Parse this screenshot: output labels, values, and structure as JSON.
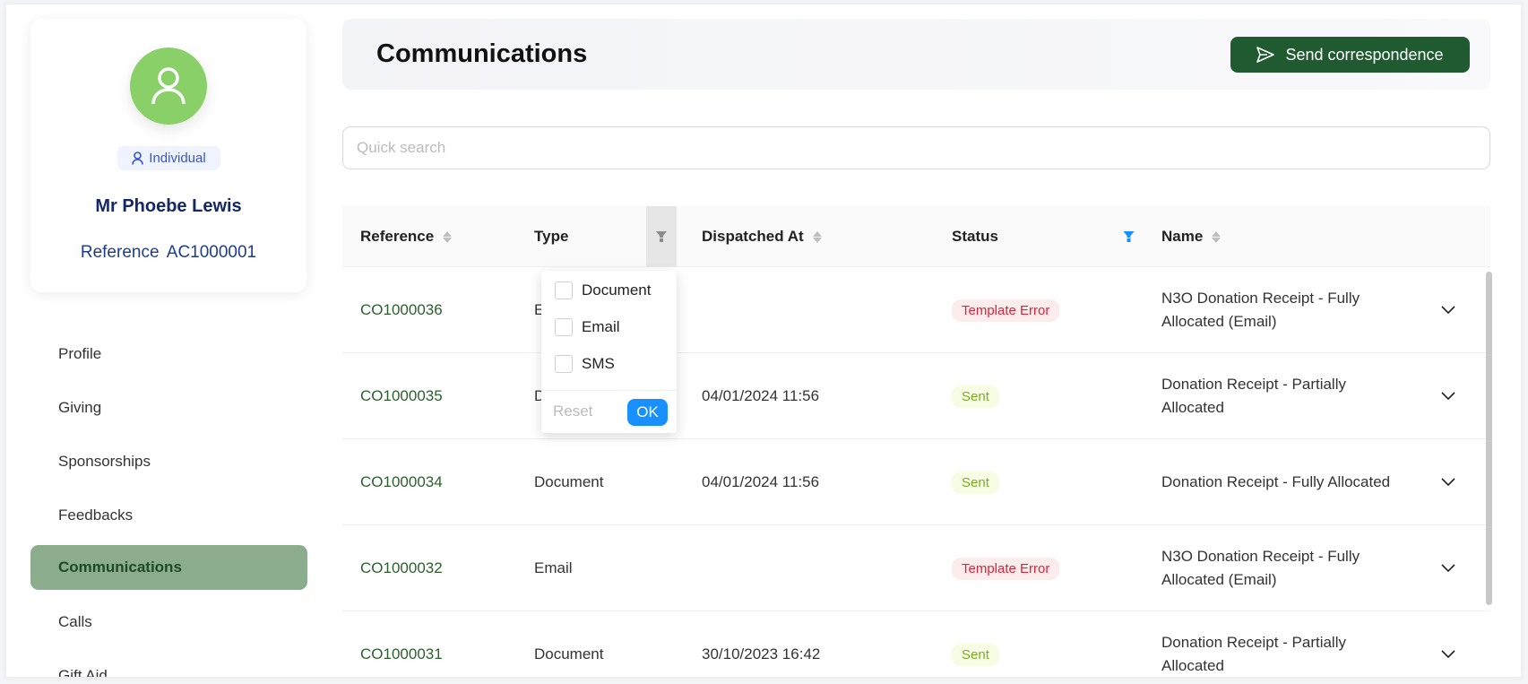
{
  "profile": {
    "type_badge": "Individual",
    "name": "Mr Phoebe Lewis",
    "reference_label": "Reference",
    "reference_value": "AC1000001",
    "avatar_color": "#8ad068"
  },
  "sidebar": {
    "items": [
      {
        "label": "Profile"
      },
      {
        "label": "Giving"
      },
      {
        "label": "Sponsorships"
      },
      {
        "label": "Feedbacks"
      },
      {
        "label": "Communications",
        "active": true
      },
      {
        "label": "Calls"
      },
      {
        "label": "Gift Aid"
      }
    ]
  },
  "header": {
    "title": "Communications",
    "send_label": "Send correspondence",
    "send_color": "#1f5a30"
  },
  "search": {
    "placeholder": "Quick search",
    "value": ""
  },
  "table": {
    "columns": [
      "Reference",
      "Type",
      "Dispatched At",
      "Status",
      "Name"
    ],
    "rows": [
      {
        "reference": "CO1000036",
        "type": "Email",
        "dispatched": "",
        "status": "Template Error",
        "name": "N3O Donation Receipt - Fully Allocated (Email)"
      },
      {
        "reference": "CO1000035",
        "type": "Document",
        "dispatched": "04/01/2024 11:56",
        "status": "Sent",
        "name": "Donation Receipt - Partially Allocated"
      },
      {
        "reference": "CO1000034",
        "type": "Document",
        "dispatched": "04/01/2024 11:56",
        "status": "Sent",
        "name": "Donation Receipt - Fully Allocated"
      },
      {
        "reference": "CO1000032",
        "type": "Email",
        "dispatched": "",
        "status": "Template Error",
        "name": "N3O Donation Receipt - Fully Allocated (Email)"
      },
      {
        "reference": "CO1000031",
        "type": "Document",
        "dispatched": "30/10/2023 16:42",
        "status": "Sent",
        "name": "Donation Receipt - Partially Allocated"
      }
    ]
  },
  "type_filter": {
    "options": [
      {
        "label": "Document",
        "checked": false
      },
      {
        "label": "Email",
        "checked": false
      },
      {
        "label": "SMS",
        "checked": false
      }
    ],
    "reset_label": "Reset",
    "ok_label": "OK"
  },
  "colors": {
    "active_nav": "#8cad8d",
    "status_filter_active": "#1890ff",
    "error": "#d7263d",
    "sent": "#7cad22"
  }
}
